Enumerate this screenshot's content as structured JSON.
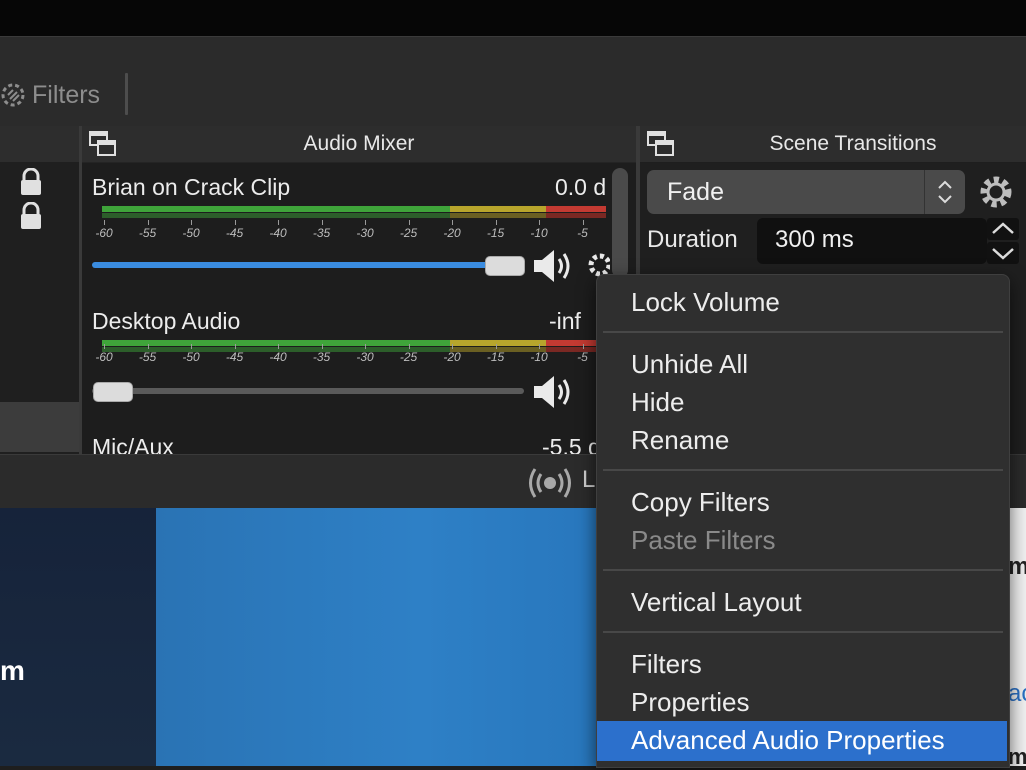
{
  "toolbar": {
    "filters_tab": "Filters"
  },
  "audio_mixer": {
    "title": "Audio Mixer",
    "sources": [
      {
        "name": "Brian on Crack Clip",
        "db": "0.0 d",
        "volume": 0.88
      },
      {
        "name": "Desktop Audio",
        "db": "-inf",
        "volume": 0.0
      },
      {
        "name": "Mic/Aux",
        "db": "-5.5 d"
      }
    ],
    "meter_ticks": [
      "-60",
      "-55",
      "-50",
      "-45",
      "-40",
      "-35",
      "-30",
      "-25",
      "-20",
      "-15",
      "-10",
      "-5"
    ],
    "colors": {
      "green": "#3fa43a",
      "yellow": "#b8a52c",
      "red": "#c33a32",
      "slider": "#3a8ce0"
    }
  },
  "scene_transitions": {
    "title": "Scene Transitions",
    "transition": "Fade",
    "duration_label": "Duration",
    "duration_value": "300 ms"
  },
  "controls": {
    "live_text": "L"
  },
  "preview": {
    "left_text": "m",
    "side_fragments": [
      "m",
      "ac",
      "m"
    ]
  },
  "context_menu": {
    "items": [
      {
        "label": "Lock Volume"
      },
      {
        "label": "Unhide All"
      },
      {
        "label": "Hide"
      },
      {
        "label": "Rename"
      },
      {
        "label": "Copy Filters"
      },
      {
        "label": "Paste Filters",
        "disabled": true
      },
      {
        "label": "Vertical Layout"
      },
      {
        "label": "Filters"
      },
      {
        "label": "Properties"
      },
      {
        "label": "Advanced Audio Properties",
        "highlighted": true
      }
    ],
    "highlight_color": "#2c70cc"
  }
}
